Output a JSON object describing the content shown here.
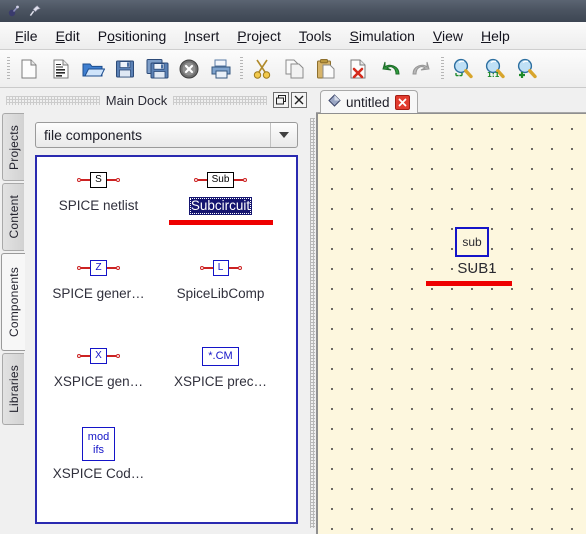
{
  "window": {
    "title": "",
    "icons": [
      "app-icon",
      "pin-icon"
    ]
  },
  "menubar": {
    "items": [
      {
        "label": "File",
        "mnemonic": "F"
      },
      {
        "label": "Edit",
        "mnemonic": "E"
      },
      {
        "label": "Positioning",
        "mnemonic": "o"
      },
      {
        "label": "Insert",
        "mnemonic": "I"
      },
      {
        "label": "Project",
        "mnemonic": "P"
      },
      {
        "label": "Tools",
        "mnemonic": "T"
      },
      {
        "label": "Simulation",
        "mnemonic": "S"
      },
      {
        "label": "View",
        "mnemonic": "V"
      },
      {
        "label": "Help",
        "mnemonic": "H"
      }
    ]
  },
  "toolbar": {
    "buttons": [
      {
        "name": "new-file-icon",
        "title": "New"
      },
      {
        "name": "new-text-file-icon",
        "title": "New text"
      },
      {
        "name": "open-folder-icon",
        "title": "Open"
      },
      {
        "name": "save-icon",
        "title": "Save"
      },
      {
        "name": "save-all-icon",
        "title": "Save all"
      },
      {
        "name": "close-document-icon",
        "title": "Close"
      },
      {
        "name": "print-icon",
        "title": "Print"
      },
      {
        "name": "cut-icon",
        "title": "Cut"
      },
      {
        "name": "copy-icon",
        "title": "Copy"
      },
      {
        "name": "paste-icon",
        "title": "Paste"
      },
      {
        "name": "delete-icon",
        "title": "Delete"
      },
      {
        "name": "undo-icon",
        "title": "Undo"
      },
      {
        "name": "redo-icon",
        "title": "Redo"
      },
      {
        "name": "zoom-fit-icon",
        "title": "Zoom fit"
      },
      {
        "name": "zoom-one-to-one-icon",
        "title": "Zoom 1:1",
        "badge": "1:1"
      },
      {
        "name": "zoom-in-icon",
        "title": "Zoom in"
      }
    ]
  },
  "dock": {
    "title": "Main Dock",
    "float_button": "restore-icon",
    "close_button": "close-icon",
    "tabs": [
      {
        "label": "Projects",
        "active": false
      },
      {
        "label": "Content",
        "active": false
      },
      {
        "label": "Components",
        "active": true
      },
      {
        "label": "Libraries",
        "active": false
      }
    ],
    "category_combo": {
      "value": "file components",
      "placeholder": "file components"
    },
    "components": [
      {
        "label": "SPICE netlist",
        "symbol": "S",
        "symbol_style": "black-leads",
        "selected": false
      },
      {
        "label": "Subcircuit",
        "symbol": "Sub",
        "symbol_style": "black-leads",
        "selected": true
      },
      {
        "label": "SPICE gener…",
        "symbol": "Z",
        "symbol_style": "blue-leads",
        "selected": false
      },
      {
        "label": "SpiceLibComp",
        "symbol": "L",
        "symbol_style": "blue-leads",
        "selected": false
      },
      {
        "label": "XSPICE gen…",
        "symbol": "X",
        "symbol_style": "blue-leads",
        "selected": false
      },
      {
        "label": "XSPICE prec…",
        "symbol": "*.CM",
        "symbol_style": "blue-plain",
        "selected": false
      },
      {
        "label": "XSPICE Cod…",
        "symbol": "mod\nifs",
        "symbol_style": "blue-plain",
        "selected": false
      }
    ]
  },
  "editor": {
    "tab": {
      "label": "untitled",
      "icon": "document-diamond-icon",
      "close_icon": "close-icon"
    },
    "canvas": {
      "background_color": "#fdf7de",
      "grid": true,
      "grid_spacing_px": 20,
      "placed_component": {
        "symbol_text": "sub",
        "name": "SUB1",
        "highlight_color": "#ee0000"
      }
    }
  },
  "colors": {
    "selection_bg": "#151570",
    "highlight_red": "#ee0000",
    "symbol_blue": "#1414c8",
    "panel_border": "#2a2ab0",
    "canvas_bg": "#fdf7de"
  }
}
